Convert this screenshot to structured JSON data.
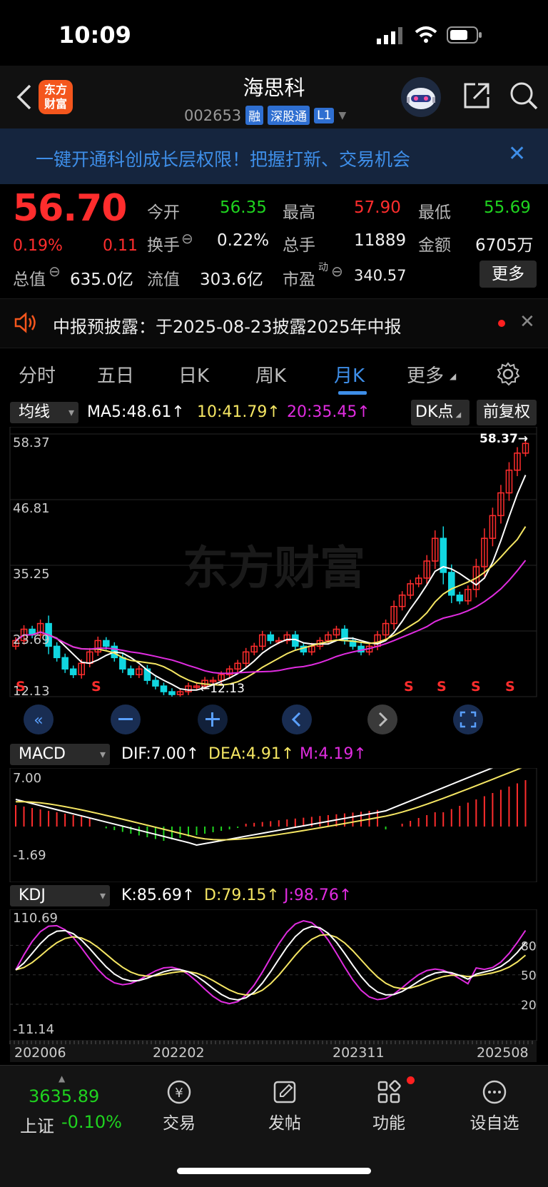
{
  "status_bar": {
    "time": "10:09"
  },
  "header": {
    "logo_text_1": "东方",
    "logo_text_2": "财富",
    "stock_name": "海思科",
    "stock_code": "002653",
    "badges": [
      "融",
      "深股通",
      "L1"
    ]
  },
  "banner": {
    "text": "一键开通科创成长层权限！把握打新、交易机会"
  },
  "quote": {
    "price": "56.70",
    "change_pct": "0.19%",
    "change_amt": "0.11",
    "fields": [
      {
        "label": "今开",
        "value": "56.35",
        "color": "#1fd31f"
      },
      {
        "label": "最高",
        "value": "57.90",
        "color": "#ff2d2d"
      },
      {
        "label": "最低",
        "value": "55.69",
        "color": "#1fd31f"
      },
      {
        "label": "换手",
        "value": "0.22%",
        "color": "#f0f0f0"
      },
      {
        "label": "总手",
        "value": "11889",
        "color": "#f0f0f0"
      },
      {
        "label": "金额",
        "value": "6705万",
        "color": "#f0f0f0"
      },
      {
        "label": "总值",
        "value": "635.0亿",
        "color": "#f0f0f0"
      },
      {
        "label": "流值",
        "value": "303.6亿",
        "color": "#f0f0f0"
      },
      {
        "label": "市盈",
        "value": "340.57",
        "color": "#f0f0f0"
      }
    ],
    "pe_superscript": "动",
    "more_label": "更多"
  },
  "notice": {
    "text": "中报预披露：于2025-08-23披露2025年中报"
  },
  "tabs": [
    "分时",
    "五日",
    "日K",
    "周K",
    "月K",
    "更多"
  ],
  "active_tab": "月K",
  "kline": {
    "selector": "均线",
    "ma5": "MA5:48.61↑",
    "ma10": "10:41.79↑",
    "ma20": "20:35.45↑",
    "dk_label": "DK点",
    "adjust_label": "前复权",
    "y_ticks": [
      "58.37",
      "46.81",
      "35.25",
      "23.69",
      "12.13"
    ],
    "max_label": "58.37→",
    "min_label": "←12.13",
    "watermark": "东方财富",
    "s_marks": [
      "S",
      "S",
      "S",
      "S",
      "S",
      "S"
    ]
  },
  "macd": {
    "selector": "MACD",
    "dif": "DIF:7.00↑",
    "dea": "DEA:4.91↑",
    "m": "M:4.19↑",
    "y_top": "7.00",
    "y_bottom": "-1.69"
  },
  "kdj": {
    "selector": "KDJ",
    "k": "K:85.69↑",
    "d": "D:79.15↑",
    "j": "J:98.76↑",
    "y_top": "110.69",
    "y_bottom": "-11.14",
    "levels": [
      "80",
      "50",
      "20"
    ],
    "x_labels": [
      "202006",
      "202202",
      "202311",
      "202508"
    ]
  },
  "bottom": {
    "index_value": "3635.89",
    "index_name": "上证",
    "index_change": "-0.10%",
    "nav": [
      "交易",
      "发帖",
      "功能",
      "设自选"
    ]
  },
  "chart_data": {
    "type": "candlestick",
    "period": "monthly",
    "x_labels": [
      "202006",
      "202202",
      "202311",
      "202508"
    ],
    "y_range": [
      12.13,
      58.37
    ],
    "close_approx": [
      22,
      24,
      23,
      25,
      21,
      19,
      17,
      16,
      18,
      20,
      22,
      21,
      19,
      17,
      16,
      17,
      15,
      14,
      13,
      12.5,
      13,
      14,
      14,
      15,
      15,
      16,
      17,
      18,
      20,
      21,
      23,
      22,
      22,
      23,
      21,
      20,
      21,
      22,
      23,
      24,
      22,
      21,
      20,
      21,
      23,
      25,
      28,
      30,
      32,
      33,
      36,
      40,
      34,
      30,
      29,
      31,
      35,
      40,
      44,
      48,
      52,
      55,
      56.7
    ]
  }
}
